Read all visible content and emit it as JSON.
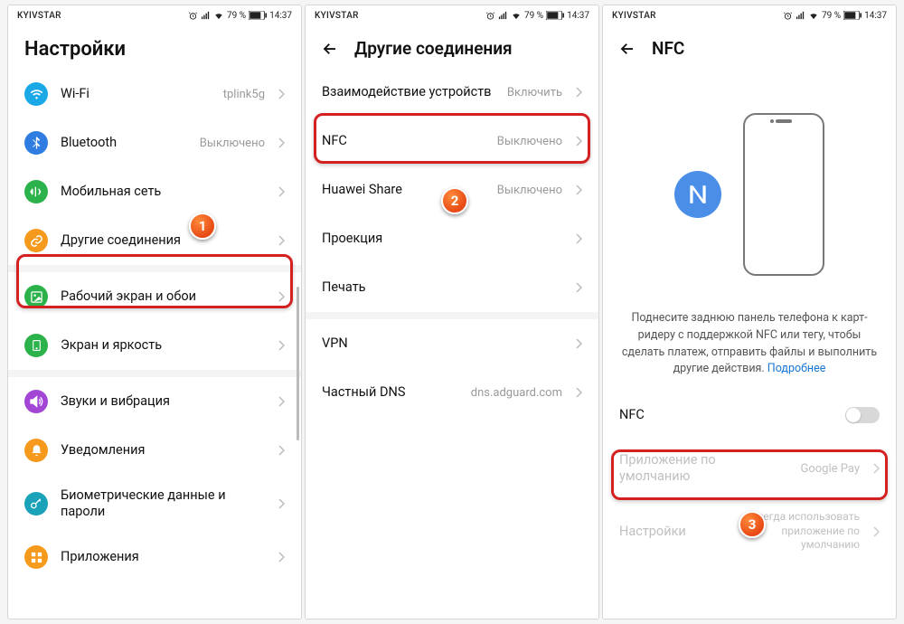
{
  "statusbar": {
    "carrier": "KYIVSTAR",
    "battery": "79 %",
    "time": "14:37"
  },
  "screen1": {
    "title": "Настройки",
    "items": [
      {
        "label": "Wi-Fi",
        "value": "tplink5g",
        "icon": "wifi",
        "color": "#1aa9e6"
      },
      {
        "label": "Bluetooth",
        "value": "Выключено",
        "icon": "bluetooth",
        "color": "#2f7de0"
      },
      {
        "label": "Мобильная сеть",
        "value": "",
        "icon": "signal",
        "color": "#2cb24a"
      },
      {
        "label": "Другие соединения",
        "value": "",
        "icon": "link",
        "color": "#f59a1d"
      },
      {
        "label": "Рабочий экран и обои",
        "value": "",
        "icon": "photo",
        "color": "#2cb24a"
      },
      {
        "label": "Экран и яркость",
        "value": "",
        "icon": "phone",
        "color": "#2cb24a"
      },
      {
        "label": "Звуки и вибрация",
        "value": "",
        "icon": "sound",
        "color": "#a346d6"
      },
      {
        "label": "Уведомления",
        "value": "",
        "icon": "bell",
        "color": "#f59a1d"
      },
      {
        "label": "Биометрические данные и пароли",
        "value": "",
        "icon": "key",
        "color": "#19a2b8"
      },
      {
        "label": "Приложения",
        "value": "",
        "icon": "grid",
        "color": "#f59a1d"
      }
    ]
  },
  "screen2": {
    "title": "Другие соединения",
    "items": [
      {
        "label": "Взаимодействие устройств",
        "value": "Включить"
      },
      {
        "label": "NFC",
        "value": "Выключено"
      },
      {
        "label": "Huawei Share",
        "value": "Выключено"
      },
      {
        "label": "Проекция",
        "value": ""
      },
      {
        "label": "Печать",
        "value": ""
      }
    ],
    "items2": [
      {
        "label": "VPN",
        "value": ""
      },
      {
        "label": "Частный DNS",
        "value": "dns.adguard.com"
      }
    ]
  },
  "screen3": {
    "title": "NFC",
    "desc": "Поднесите заднюю панель телефона к карт-ридеру с поддержкой NFC или тегу, чтобы сделать платеж, отправить файлы и выполнить другие действия.",
    "link": "Подробнее",
    "toggle_label": "NFC",
    "app_label": "Приложение по умолчанию",
    "app_value": "Google Pay",
    "settings_label": "Настройки",
    "settings_value": "Всегда использовать приложение по умолчанию"
  },
  "callouts": {
    "c1": "1",
    "c2": "2",
    "c3": "3"
  }
}
